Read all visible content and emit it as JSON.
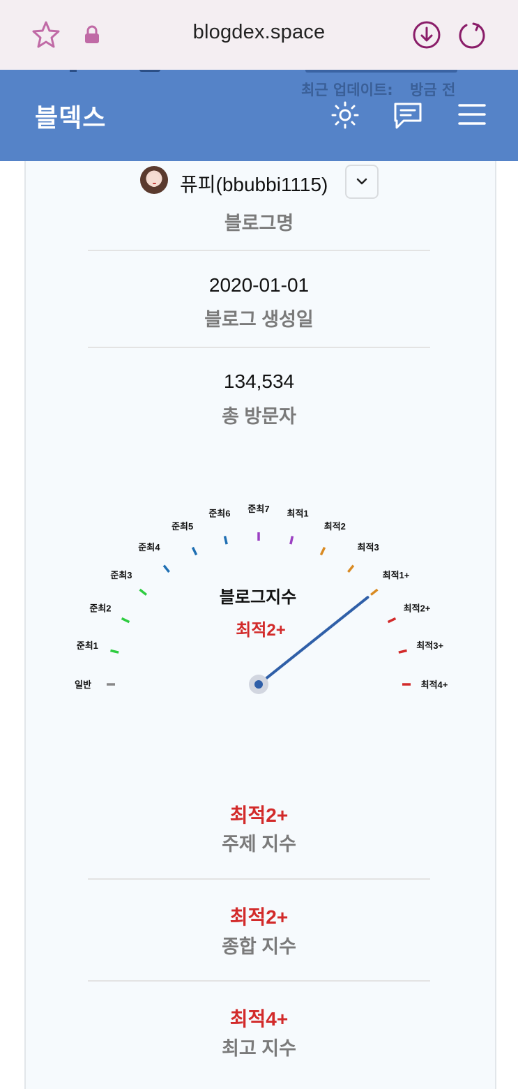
{
  "browser": {
    "url": "blogdex.space"
  },
  "header": {
    "app_title": "블덱스",
    "update_label": "최근 업데이트:",
    "update_value": "방금 전"
  },
  "profile": {
    "name": "퓨피(bbubbi1115)",
    "blog_name_label": "블로그명"
  },
  "stats": {
    "created_value": "2020-01-01",
    "created_label": "블로그 생성일",
    "visitors_value": "134,534",
    "visitors_label": "총 방문자"
  },
  "gauge": {
    "title": "블로그지수",
    "current": "최적2+",
    "current_index": 11,
    "levels": [
      "일반",
      "준최1",
      "준최2",
      "준최3",
      "준최4",
      "준최5",
      "준최6",
      "준최7",
      "최적1",
      "최적2",
      "최적3",
      "최적1+",
      "최적2+",
      "최적3+",
      "최적4+"
    ],
    "tick_colors": [
      "#888888",
      "#2ecc40",
      "#2ecc40",
      "#2ecc40",
      "#1f6fb3",
      "#1f6fb3",
      "#1f6fb3",
      "#9b3fc2",
      "#9b3fc2",
      "#d98a22",
      "#d98a22",
      "#d98a22",
      "#d22a2a",
      "#d22a2a",
      "#d22a2a"
    ],
    "needle_color": "#2f5fa8"
  },
  "indices": [
    {
      "value": "최적2+",
      "label": "주제 지수"
    },
    {
      "value": "최적2+",
      "label": "종합 지수"
    },
    {
      "value": "최적4+",
      "label": "최고 지수"
    }
  ],
  "icons": {
    "star": "star-icon",
    "lock": "lock-icon",
    "download": "download-icon",
    "refresh": "refresh-icon",
    "theme": "sun-icon",
    "chat": "chat-icon",
    "menu": "menu-icon",
    "dropdown": "chevron-down-icon"
  }
}
